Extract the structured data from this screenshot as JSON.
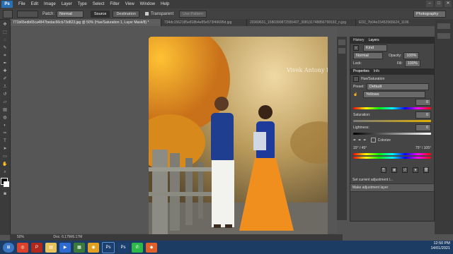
{
  "menu": {
    "logo": "Ps",
    "items": [
      "File",
      "Edit",
      "Image",
      "Layer",
      "Type",
      "Select",
      "Filter",
      "View",
      "Window",
      "Help"
    ]
  },
  "options": {
    "patch_label": "Patch:",
    "patch_value": "Normal",
    "source_label": "Source",
    "destination_label": "Destination",
    "transparent_label": "Transparent",
    "use_pattern_label": "Use Pattern",
    "workspace": "Photography"
  },
  "tabs": [
    "771b65edb65ca4847bedac66cb73d823.jpg @ 50% (Hue/Saturation 1, Layer Mask/8) *",
    "734dc1562185e818b4e85e573f49695d.jpg",
    "20369631_1580390872555407_308131748856799192_n.jpg",
    "ED2_7b04e15452565624_1106"
  ],
  "photo": {
    "watermark": "Vivek Antony Photography"
  },
  "status": {
    "zoom": "50%",
    "doc": "Doc: 6.17M/6.17M"
  },
  "panel": {
    "history_label": "History",
    "layers_label": "Layers",
    "kind_label": "Kind",
    "blend_mode": "Normal",
    "opacity_label": "Opacity:",
    "opacity_value": "100%",
    "lock_label": "Lock:",
    "fill_label": "Fill:",
    "fill_value": "100%",
    "properties_tab": "Properties",
    "info_tab": "Info",
    "adjustment_title": "Hue/Saturation",
    "preset_label": "Preset:",
    "preset_value": "Default",
    "channel_value": "Yellows",
    "hue_value": "0",
    "saturation_label": "Saturation:",
    "saturation_value": "0",
    "lightness_label": "Lightness:",
    "lightness_value": "0",
    "colorize_label": "Colorize",
    "range_left": "15° / 45°",
    "range_right": "75° \\ 105°",
    "history_items": [
      "Set current adjustment l...",
      "Make adjustment layer"
    ]
  },
  "taskbar": {
    "time": "12:50 PM",
    "date": "14/01/2021"
  },
  "colors": {
    "accent_blue": "#2a6fb3",
    "taskbar": "#1d3c63"
  }
}
